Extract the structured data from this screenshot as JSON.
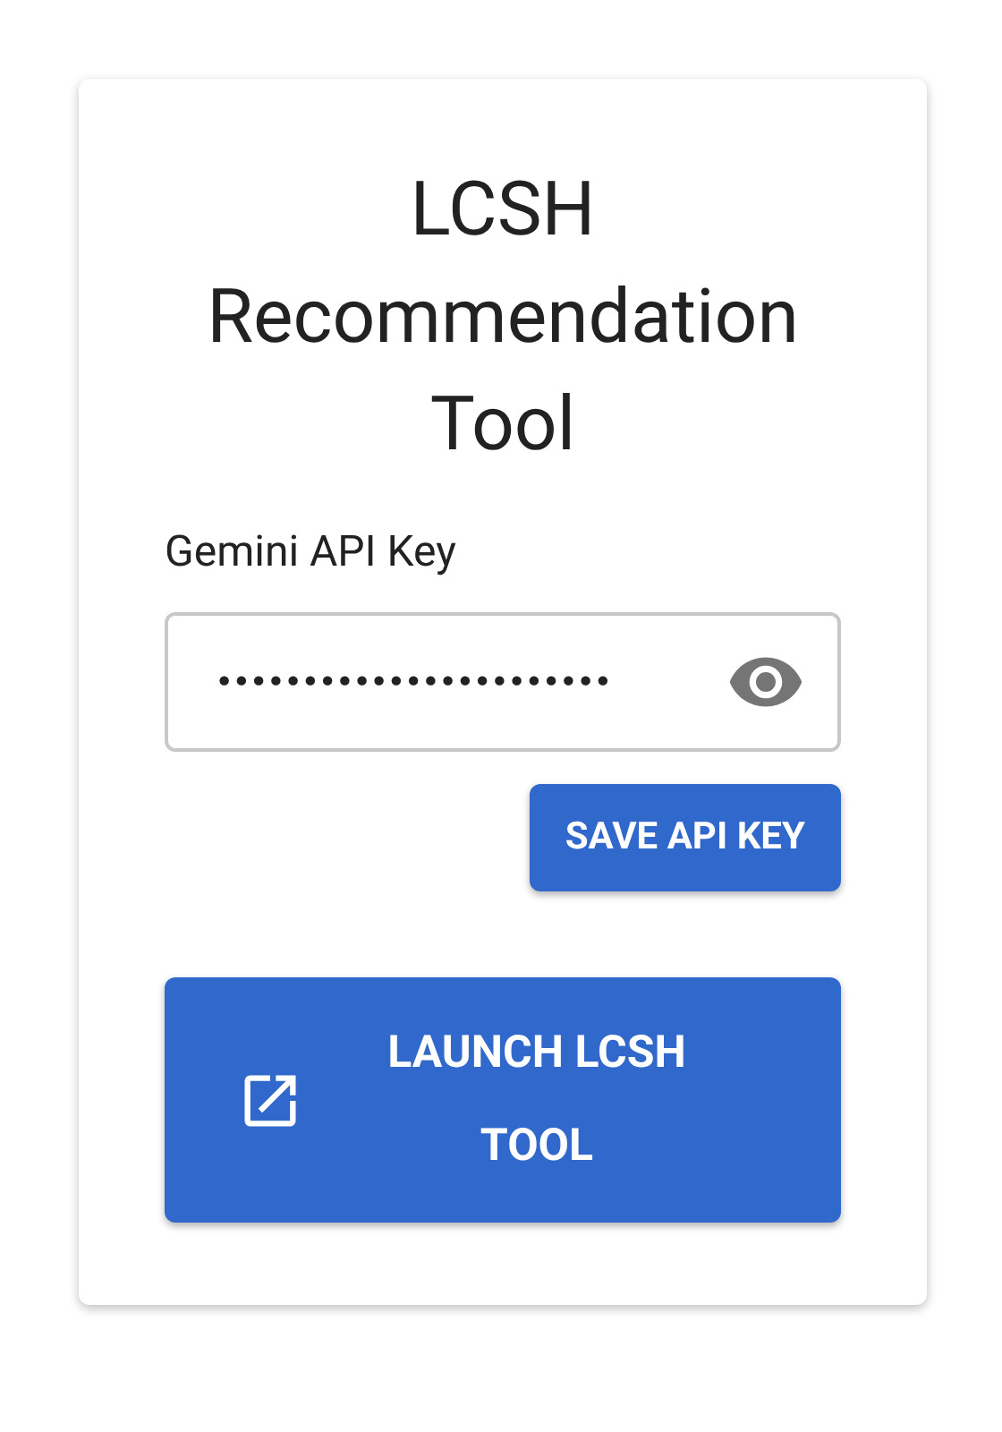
{
  "title": "LCSH Recommendation Tool",
  "api_key_field": {
    "label": "Gemini API Key",
    "value": "•••••••••••••••••••••••",
    "masked": true
  },
  "save_button": {
    "label": "SAVE API KEY"
  },
  "launch_button": {
    "label": "LAUNCH LCSH TOOL"
  }
}
